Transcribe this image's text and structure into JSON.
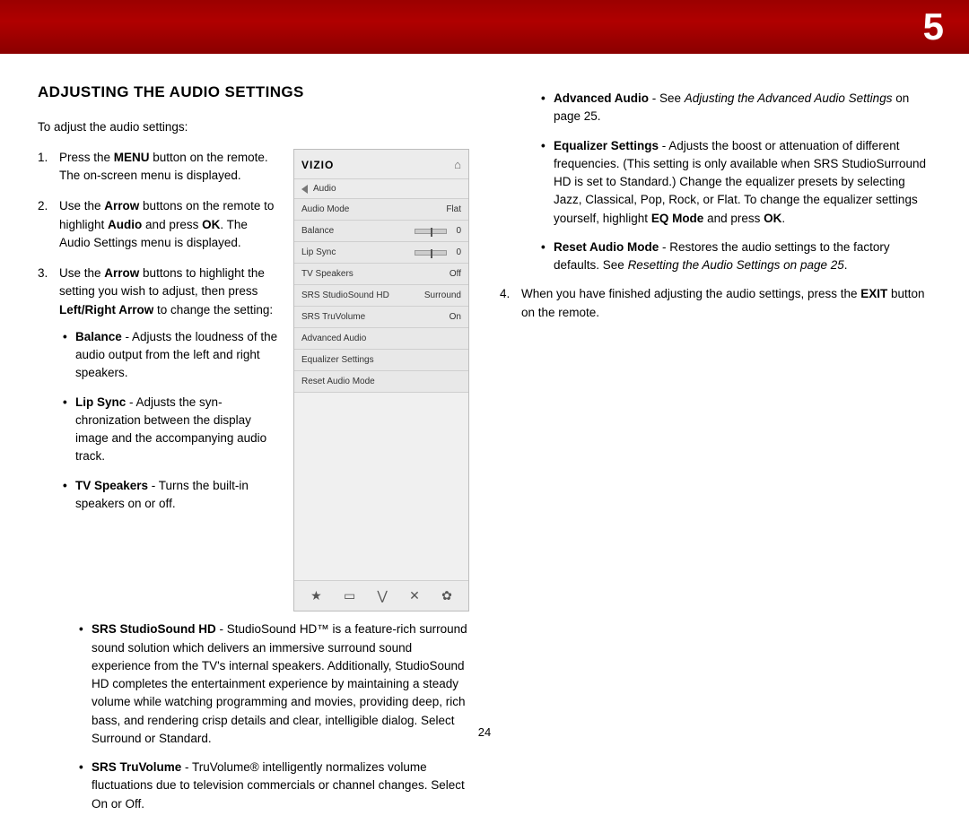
{
  "chapter": "5",
  "page_number": "24",
  "heading": "ADJUSTING THE AUDIO SETTINGS",
  "intro": "To adjust the audio settings:",
  "step1": {
    "a": "Press the ",
    "b": "MENU",
    "c": " button on the remote. The on-screen menu is displayed."
  },
  "step2": {
    "a": "Use the ",
    "b": "Arrow",
    "c": " buttons on the remote to highlight ",
    "d": "Audio",
    "e": " and press ",
    "f": "OK",
    "g": ". The Audio Settings menu is displayed."
  },
  "step3": {
    "a": "Use the ",
    "b": "Arrow",
    "c": " buttons to highlight the setting you wish to adjust, then press ",
    "d": "Left/Right Arrow",
    "e": " to change the setting:"
  },
  "sub": {
    "balance": {
      "t": "Balance",
      "d": " - Adjusts the loudness of the audio output from the left and right speakers."
    },
    "lipsync": {
      "t": "Lip Sync",
      "d": " - Adjusts the syn-chronization between the display image and the accompanying audio track."
    },
    "tvspk": {
      "t": "TV Speakers",
      "d": " - Turns the built-in speakers on or off."
    },
    "srs_ss": {
      "t": "SRS StudioSound HD",
      "d": " - StudioSound HD™ is a feature-rich surround sound solution which delivers an immersive surround sound experience from the TV's internal speakers. Additionally, StudioSound HD completes the entertainment experience by maintaining a steady volume while watching programming and movies, providing deep, rich bass, and rendering crisp details and clear, intelligible dialog. Select Surround or Standard."
    },
    "srs_tv": {
      "t": "SRS TruVolume",
      "d": " - TruVolume® intelligently normalizes volume fluctuations due to television commercials or channel changes. Select On or Off."
    },
    "adv": {
      "t": "Advanced Audio",
      "d1": " - See ",
      "it": "Adjusting the Advanced Audio Settings",
      "d2": " on page 25."
    },
    "eq": {
      "t": "Equalizer Settings",
      "d1": " - Adjusts the boost or attenuation of different frequencies. (This setting is only available when SRS StudioSurround HD is set to Standard.) Change the equalizer presets by selecting Jazz, Classical, Pop, Rock, or Flat. To change the equalizer settings yourself, highlight ",
      "b1": "EQ Mode",
      "d2": " and press ",
      "b2": "OK",
      "d3": "."
    },
    "reset": {
      "t": "Reset Audio Mode",
      "d1": " - Restores the audio settings to the factory defaults. See ",
      "it": "Resetting the Audio Settings on page 25",
      "d2": "."
    }
  },
  "step4": {
    "a": "When you have finished adjusting the audio settings, press the ",
    "b": "EXIT",
    "c": " button on the remote."
  },
  "osd": {
    "logo": "VIZIO",
    "breadcrumb": "Audio",
    "rows": [
      {
        "label": "Audio Mode",
        "value": "Flat",
        "slider": false
      },
      {
        "label": "Balance",
        "value": "0",
        "slider": true
      },
      {
        "label": "Lip Sync",
        "value": "0",
        "slider": true
      },
      {
        "label": "TV Speakers",
        "value": "Off",
        "slider": false
      },
      {
        "label": "SRS StudioSound HD",
        "value": "Surround",
        "slider": false
      },
      {
        "label": "SRS TruVolume",
        "value": "On",
        "slider": false
      },
      {
        "label": "Advanced Audio",
        "value": "",
        "slider": false
      },
      {
        "label": "Equalizer Settings",
        "value": "",
        "slider": false
      },
      {
        "label": "Reset Audio Mode",
        "value": "",
        "slider": false
      }
    ],
    "footer_icons": [
      "★",
      "▭",
      "⋁",
      "✕",
      "✿"
    ]
  }
}
